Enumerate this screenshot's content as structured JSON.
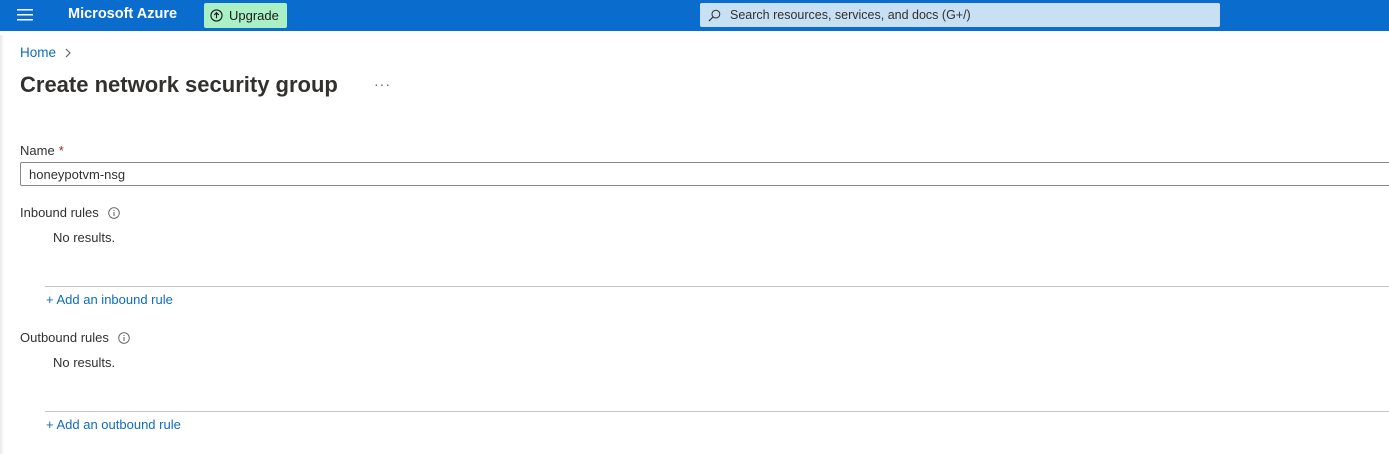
{
  "header": {
    "brand": "Microsoft Azure",
    "upgrade_label": "Upgrade",
    "search_placeholder": "Search resources, services, and docs (G+/)"
  },
  "breadcrumb": {
    "home": "Home"
  },
  "page": {
    "title": "Create network security group",
    "more": "···"
  },
  "form": {
    "name_label": "Name",
    "required_mark": "*",
    "name_value": "honeypotvm-nsg",
    "inbound": {
      "label": "Inbound rules",
      "empty_text": "No results.",
      "add_link": "+ Add an inbound rule"
    },
    "outbound": {
      "label": "Outbound rules",
      "empty_text": "No results.",
      "add_link": "+ Add an outbound rule"
    }
  },
  "colors": {
    "topbar": "#0a6ccc",
    "upgrade_bg": "#a9f0c5",
    "search_bg": "#c7e0f4",
    "link": "#0f6cbd",
    "required": "#a4262c"
  }
}
